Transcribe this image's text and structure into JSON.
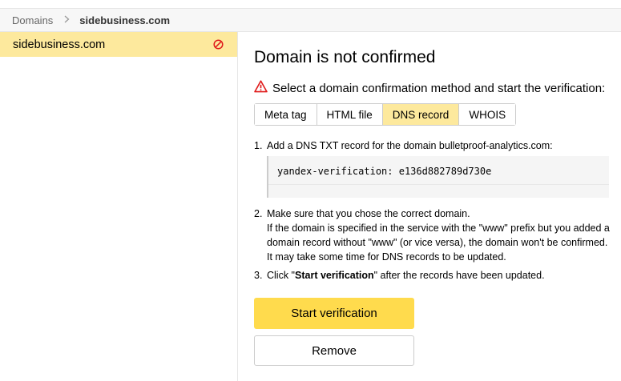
{
  "breadcrumb": {
    "root": "Domains",
    "current": "sidebusiness.com"
  },
  "sidebar": {
    "items": [
      {
        "label": "sidebusiness.com",
        "status_icon": "not-allowed-icon"
      }
    ]
  },
  "main": {
    "title": "Domain is not confirmed",
    "warning": "Select a domain confirmation method and start the verification:",
    "tabs": [
      {
        "label": "Meta tag"
      },
      {
        "label": "HTML file"
      },
      {
        "label": "DNS record",
        "active": true
      },
      {
        "label": "WHOIS"
      }
    ],
    "step1": {
      "num": "1.",
      "text": "Add a DNS TXT record for the domain bulletproof-analytics.com:"
    },
    "code": "yandex-verification: e136d882789d730e",
    "step2": {
      "num": "2.",
      "line1": "Make sure that you chose the correct domain.",
      "line2": "If the domain is specified in the service with the \"www\" prefix but you added a domain record without \"www\" (or vice versa), the domain won't be confirmed. It may take some time for DNS records to be updated."
    },
    "step3": {
      "num": "3.",
      "prefix": "Click \"",
      "bold": "Start verification",
      "suffix": "\" after the records have been updated."
    },
    "start_button": "Start verification",
    "remove_button": "Remove"
  },
  "colors": {
    "accent": "#ffdb4d",
    "selected_bg": "#fde99d",
    "error": "#e01b1b"
  }
}
